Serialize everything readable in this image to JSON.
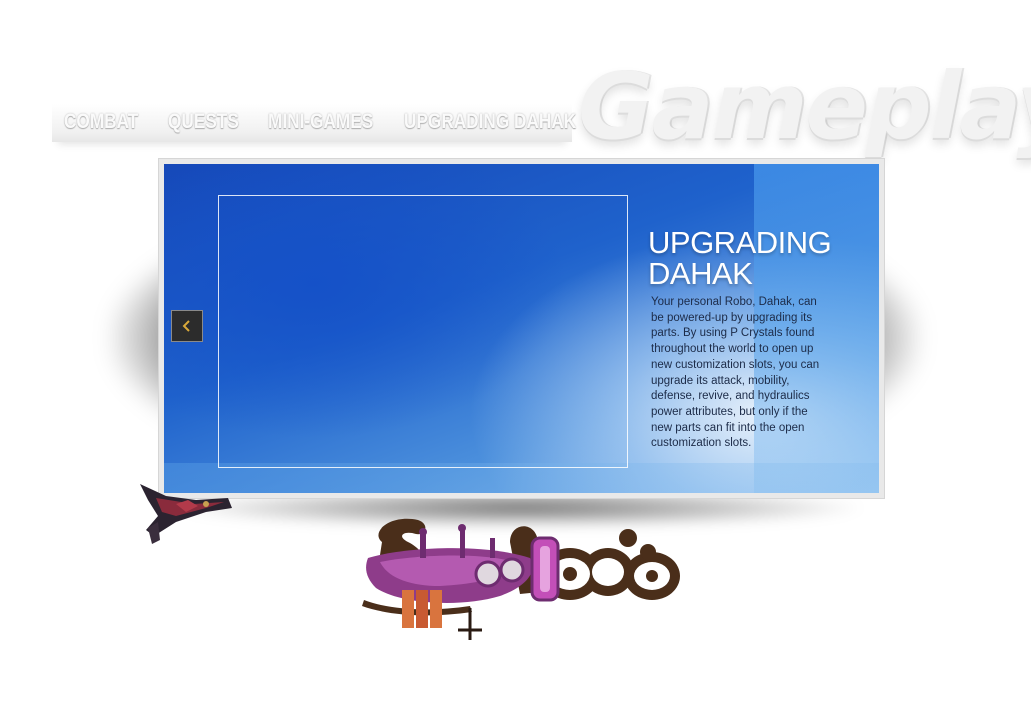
{
  "header": {
    "title": "Gameplay"
  },
  "nav": {
    "items": [
      {
        "label": "COMBAT"
      },
      {
        "label": "QUESTS"
      },
      {
        "label": "MINI-GAMES"
      },
      {
        "label": "UPGRADING DAHAK"
      }
    ]
  },
  "panel": {
    "title": "UPGRADING DAHAK",
    "body": "Your personal Robo, Dahak, can be powered-up by upgrading its parts. By using P Crystals found throughout the world to open up new customization slots, you can upgrade its attack, mobility, defense, revive, and hydraulics power attributes, but only if the new parts can fit into the open customization slots.",
    "prev_icon": "chevron-left-icon"
  },
  "colors": {
    "panel_blue": "#1f62cc",
    "nav_text": "#fafafa",
    "body_text": "#1c2b48",
    "prev_chevron": "#d9a93a"
  }
}
